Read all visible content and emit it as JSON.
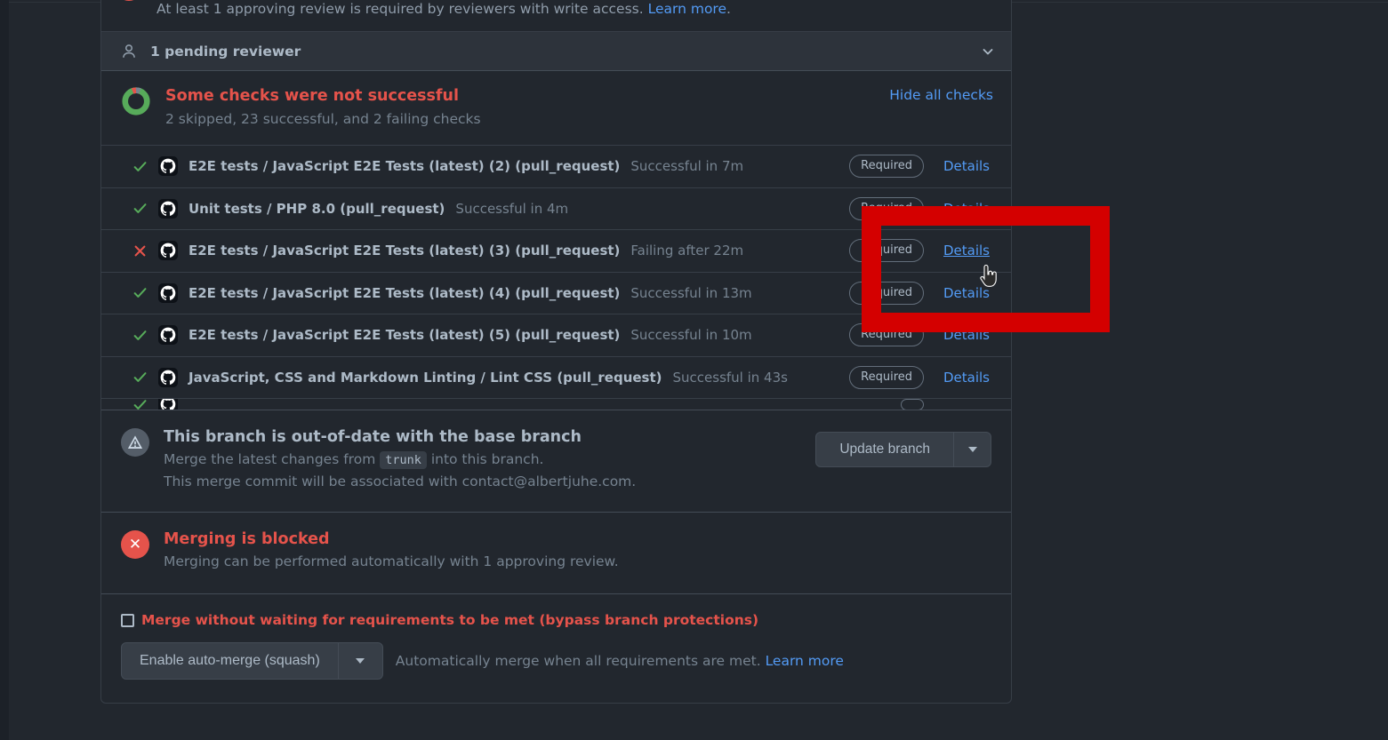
{
  "review_banner": {
    "text_before": "At least 1 approving review is required by reviewers with write access.",
    "link": "Learn more",
    "text_after": ".",
    "icon": "x-circle-icon"
  },
  "pending_reviewer": {
    "label": "1 pending reviewer",
    "icon": "person-icon",
    "expand_icon": "chevron-down-icon"
  },
  "checks": {
    "status_icon": "donut-progress-icon",
    "title": "Some checks were not successful",
    "summary": "2 skipped, 23 successful, and 2 failing checks",
    "toggle_label": "Hide all checks",
    "required_badge": "Required",
    "details_label": "Details",
    "rows": [
      {
        "state": "success",
        "app_icon": "github-actions-icon",
        "name": "E2E tests / JavaScript E2E Tests (latest) (2) (pull_request)",
        "desc": "Successful in 7m",
        "required": "Required",
        "details": "Details"
      },
      {
        "state": "success",
        "app_icon": "github-actions-icon",
        "name": "Unit tests / PHP 8.0 (pull_request)",
        "desc": "Successful in 4m",
        "required": "Required",
        "details": "Details"
      },
      {
        "state": "failure",
        "app_icon": "github-actions-icon",
        "name": "E2E tests / JavaScript E2E Tests (latest) (3) (pull_request)",
        "desc": "Failing after 22m",
        "required": "Required",
        "details": "Details"
      },
      {
        "state": "success",
        "app_icon": "github-actions-icon",
        "name": "E2E tests / JavaScript E2E Tests (latest) (4) (pull_request)",
        "desc": "Successful in 13m",
        "required": "Required",
        "details": "Details"
      },
      {
        "state": "success",
        "app_icon": "github-actions-icon",
        "name": "E2E tests / JavaScript E2E Tests (latest) (5) (pull_request)",
        "desc": "Successful in 10m",
        "required": "Required",
        "details": "Details"
      },
      {
        "state": "success",
        "app_icon": "github-actions-icon",
        "name": "JavaScript, CSS and Markdown Linting / Lint CSS (pull_request)",
        "desc": "Successful in 43s",
        "required": "Required",
        "details": "Details"
      }
    ]
  },
  "out_of_date": {
    "icon": "alert-icon",
    "title": "This branch is out-of-date with the base branch",
    "line1_before": "Merge the latest changes from",
    "branch": "trunk",
    "line1_after": "into this branch.",
    "line2": "This merge commit will be associated with contact@albertjuhe.com.",
    "button_label": "Update branch",
    "button_caret": "chevron-down-icon"
  },
  "blocked": {
    "icon": "x-circle-icon",
    "title": "Merging is blocked",
    "subtitle": "Merging can be performed automatically with 1 approving review."
  },
  "bypass": {
    "checkbox_label": "Merge without waiting for requirements to be met (bypass branch protections)",
    "checked": false,
    "automerge_button": "Enable auto-merge (squash)",
    "automerge_caret": "chevron-down-icon",
    "note_text": "Automatically merge when all requirements are met.",
    "note_link": "Learn more"
  },
  "annotation": {
    "type": "highlight-rectangle",
    "color": "#d40000"
  },
  "cursor": {
    "type": "pointer-hand-cursor"
  },
  "colors": {
    "page_bg": "#22272e",
    "border": "#373e47",
    "text_primary": "#adbac7",
    "text_muted": "#768390",
    "link": "#539bf5",
    "danger": "#e5534b",
    "success": "#57ab5a",
    "annotation": "#d40000"
  }
}
